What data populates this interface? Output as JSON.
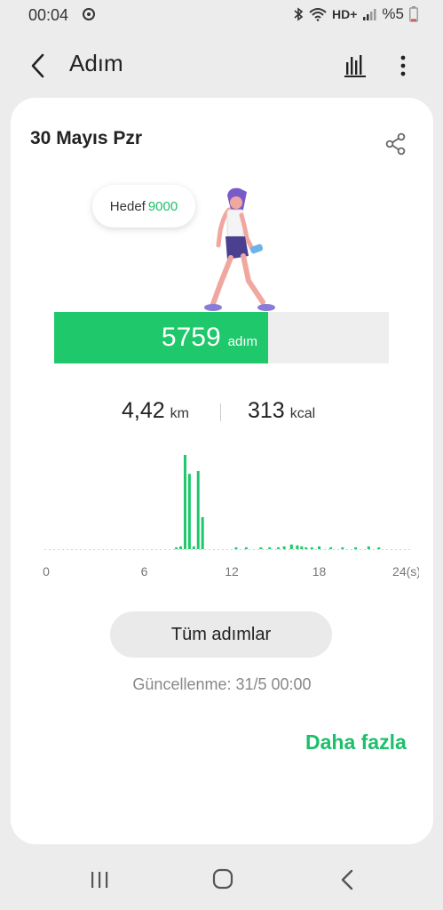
{
  "status_bar": {
    "time": "00:04",
    "network": "HD+",
    "battery": "%5"
  },
  "app_bar": {
    "title": "Adım"
  },
  "card": {
    "date": "30 Mayıs Pzr",
    "goal": {
      "label": "Hedef",
      "value": "9000"
    },
    "steps": {
      "value": "5759",
      "unit": "adım",
      "progress_fraction": 0.64
    },
    "distance": {
      "value": "4,42",
      "unit": "km"
    },
    "calories": {
      "value": "313",
      "unit": "kcal"
    },
    "all_steps_button": "Tüm adımlar",
    "updated": "Güncellenme: 31/5 00:00",
    "more_link": "Daha fazla"
  },
  "chart_data": {
    "type": "bar",
    "x_ticks": [
      "0",
      "6",
      "12",
      "18",
      "24(s)"
    ],
    "xlim": [
      0,
      24
    ],
    "bar_color": "#1ec86b",
    "x": [
      8.2,
      8.5,
      8.8,
      9.1,
      9.4,
      9.7,
      10.0,
      12.3,
      13.0,
      14.0,
      14.6,
      15.2,
      15.6,
      16.1,
      16.5,
      16.8,
      17.1,
      17.5,
      18.0,
      18.8,
      19.6,
      20.5,
      21.4,
      22.1
    ],
    "values": [
      2,
      3,
      100,
      80,
      3,
      83,
      34,
      2,
      2,
      2,
      2,
      2,
      3,
      5,
      4,
      3,
      2,
      2,
      3,
      2,
      2,
      2,
      3,
      2
    ],
    "value_unit": "relative"
  },
  "colors": {
    "accent": "#1ec86b",
    "accent_text": "#1dbf6a",
    "track": "#eeeeee",
    "background": "#ececec"
  },
  "icons": {
    "back": "chevron-left-icon",
    "chart": "bar-chart-icon",
    "more": "more-vertical-icon",
    "share": "share-icon",
    "nav_recent": "recent-apps-icon",
    "nav_home": "home-icon",
    "nav_back": "back-icon"
  }
}
